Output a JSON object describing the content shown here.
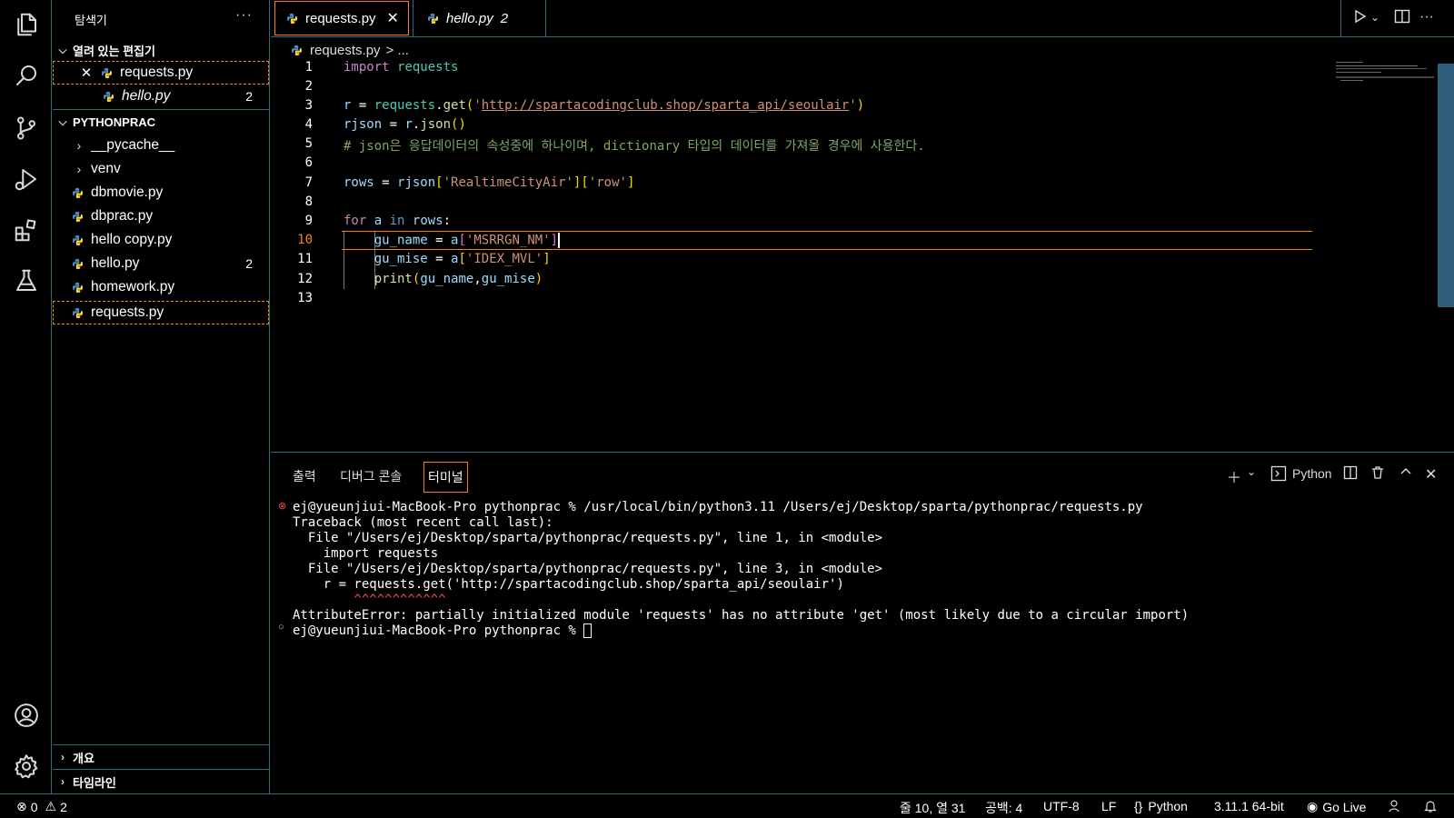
{
  "explorer": {
    "title": "탐색기",
    "more": "···",
    "open_editors_label": "열려 있는 편집기",
    "open_editors": [
      {
        "name": "requests.py",
        "badge": ""
      },
      {
        "name": "hello.py",
        "badge": "2"
      }
    ],
    "folder_label": "PYTHONPRAC",
    "folders": [
      "__pycache__",
      "venv"
    ],
    "files": [
      {
        "name": "dbmovie.py",
        "badge": ""
      },
      {
        "name": "dbprac.py",
        "badge": ""
      },
      {
        "name": "hello copy.py",
        "badge": ""
      },
      {
        "name": "hello.py",
        "badge": "2"
      },
      {
        "name": "homework.py",
        "badge": ""
      },
      {
        "name": "requests.py",
        "badge": ""
      }
    ],
    "outline_label": "개요",
    "timeline_label": "타임라인"
  },
  "tabs": [
    {
      "label": "requests.py",
      "count": ""
    },
    {
      "label": "hello.py",
      "count": "2"
    }
  ],
  "breadcrumb": {
    "file": "requests.py",
    "rest": "> ..."
  },
  "editor": {
    "line_numbers": [
      "1",
      "2",
      "3",
      "4",
      "5",
      "6",
      "7",
      "8",
      "9",
      "10",
      "11",
      "12",
      "13"
    ],
    "current_line": 10,
    "url": "http://spartacodingclub.shop/sparta_api/seoulair",
    "comment": "# json은 응답데이터의 속성중에 하나이며, dictionary 타입의 데이터를 가져올 경우에 사용한다.",
    "key_realtime": "'RealtimeCityAir'",
    "key_row": "'row'",
    "key_name": "'MSRRGN_NM'",
    "key_mise": "'IDEX_MVL'"
  },
  "panel": {
    "tabs": [
      "출력",
      "디버그 콘솔",
      "터미널"
    ],
    "active_tab": "터미널",
    "shell_label": "Python",
    "terminal_lines": [
      "ej@yueunjiui-MacBook-Pro pythonprac % /usr/local/bin/python3.11 /Users/ej/Desktop/sparta/pythonprac/requests.py",
      "Traceback (most recent call last):",
      "  File \"/Users/ej/Desktop/sparta/pythonprac/requests.py\", line 1, in <module>",
      "    import requests",
      "  File \"/Users/ej/Desktop/sparta/pythonprac/requests.py\", line 3, in <module>",
      "    r = requests.get('http://spartacodingclub.shop/sparta_api/seoulair')",
      "        ^^^^^^^^^^^^",
      "AttributeError: partially initialized module 'requests' has no attribute 'get' (most likely due to a circular import)",
      "ej@yueunjiui-MacBook-Pro pythonprac % "
    ]
  },
  "status": {
    "errors": "0",
    "warnings": "2",
    "position": "줄 10, 열 31",
    "spaces": "공백: 4",
    "encoding": "UTF-8",
    "eol": "LF",
    "language": "Python",
    "interpreter": "3.11.1 64-bit",
    "golive": "Go Live"
  },
  "colors": {
    "accent": "#f38518",
    "border": "#2b6f7a",
    "error": "#f14c4c"
  }
}
